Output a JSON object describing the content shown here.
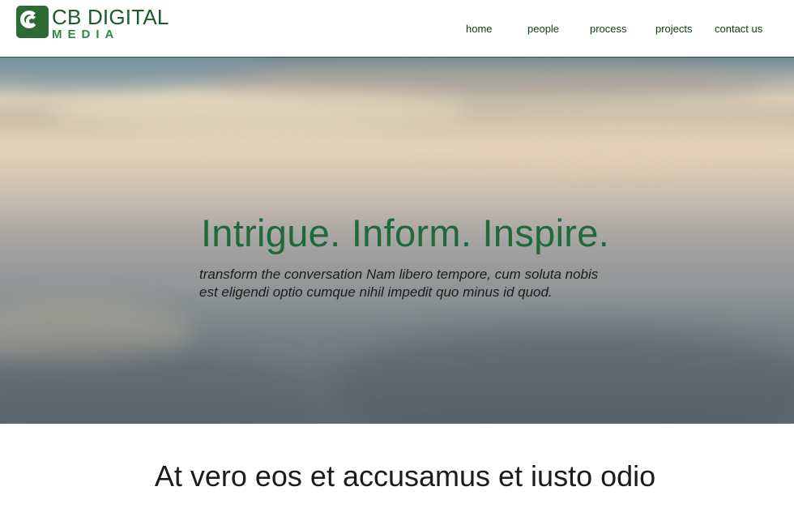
{
  "logo": {
    "line1": "CB DIGITAL",
    "line2": "MEDIA",
    "brand_color": "#2e6b34",
    "accent_color": "#2e8a3e"
  },
  "nav": {
    "items": [
      "home",
      "people",
      "process",
      "projects",
      "contact us"
    ]
  },
  "hero": {
    "title": "Intrigue.  Inform.  Inspire.",
    "subtitle_line1": "transform the conversation Nam libero tempore, cum soluta nobis",
    "subtitle_line2": "est eligendi optio cumque nihil impedit quo minus id quod.",
    "title_color": "#1e6a3a"
  },
  "section": {
    "heading": "At vero eos et accusamus et iusto odio"
  }
}
